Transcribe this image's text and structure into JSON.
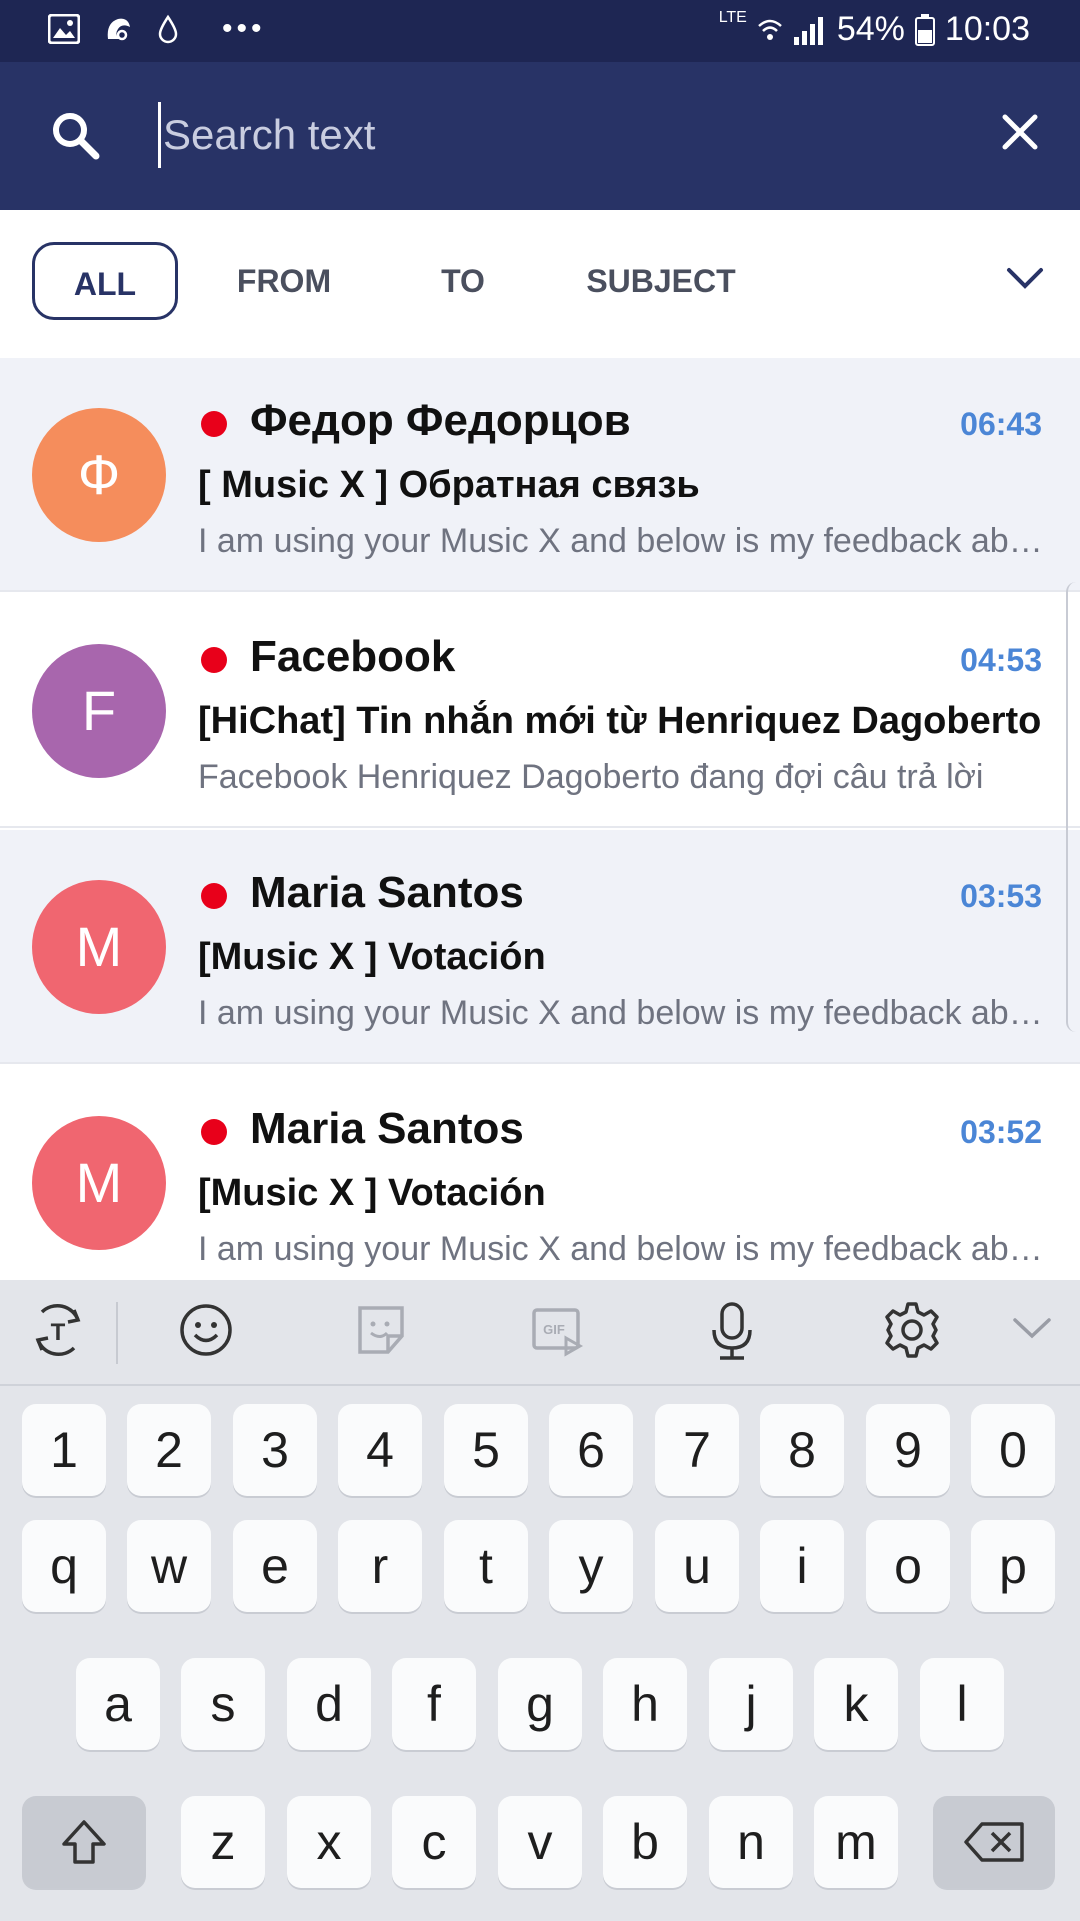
{
  "status_bar": {
    "battery": "54%",
    "time": "10:03",
    "network": "LTE",
    "dots": "•••"
  },
  "search": {
    "placeholder": "Search text",
    "value": ""
  },
  "filters": [
    "ALL",
    "FROM",
    "TO",
    "SUBJECT"
  ],
  "emails": [
    {
      "avatar_letter": "Ф",
      "avatar_color": "#f58d5c",
      "sender": "Федор Федорцов",
      "time": "06:43",
      "subject": "[ Music X ] Обратная связь",
      "preview": "I am using your Music X and below is my feedback about it"
    },
    {
      "avatar_letter": "F",
      "avatar_color": "#a866ad",
      "sender": "Facebook",
      "time": "04:53",
      "subject": "[HiChat] Tin nhắn mới từ Henriquez Dagoberto",
      "preview": "Facebook   Henriquez Dagoberto đang đợi câu trả lời"
    },
    {
      "avatar_letter": "M",
      "avatar_color": "#f06670",
      "sender": "Maria Santos",
      "time": "03:53",
      "subject": "[Music X ] Votación",
      "preview": "I am using your Music X and below is my feedback about it"
    },
    {
      "avatar_letter": "M",
      "avatar_color": "#f06670",
      "sender": "Maria Santos",
      "time": "03:52",
      "subject": "[Music X ] Votación",
      "preview": "I am using your Music X and below is my feedback about it"
    }
  ],
  "keyboard": {
    "row_numbers": [
      "1",
      "2",
      "3",
      "4",
      "5",
      "6",
      "7",
      "8",
      "9",
      "0"
    ],
    "row_1": [
      "q",
      "w",
      "e",
      "r",
      "t",
      "y",
      "u",
      "i",
      "o",
      "p"
    ],
    "row_2": [
      "a",
      "s",
      "d",
      "f",
      "g",
      "h",
      "j",
      "k",
      "l"
    ],
    "row_3": [
      "z",
      "x",
      "c",
      "v",
      "b",
      "n",
      "m"
    ]
  },
  "toolbar": {
    "gif_label": "GIF"
  },
  "colors": {
    "status_bar": "#1e2653",
    "header": "#283366",
    "accent_time": "#4b86d6",
    "unread_dot": "#e8001a"
  },
  "icons": [
    "search-icon",
    "close-icon",
    "chevron-down-icon",
    "translate-icon",
    "emoji-icon",
    "sticker-icon",
    "gif-icon",
    "microphone-icon",
    "gear-icon",
    "hide-keyboard-icon",
    "shift-icon",
    "backspace-icon"
  ]
}
